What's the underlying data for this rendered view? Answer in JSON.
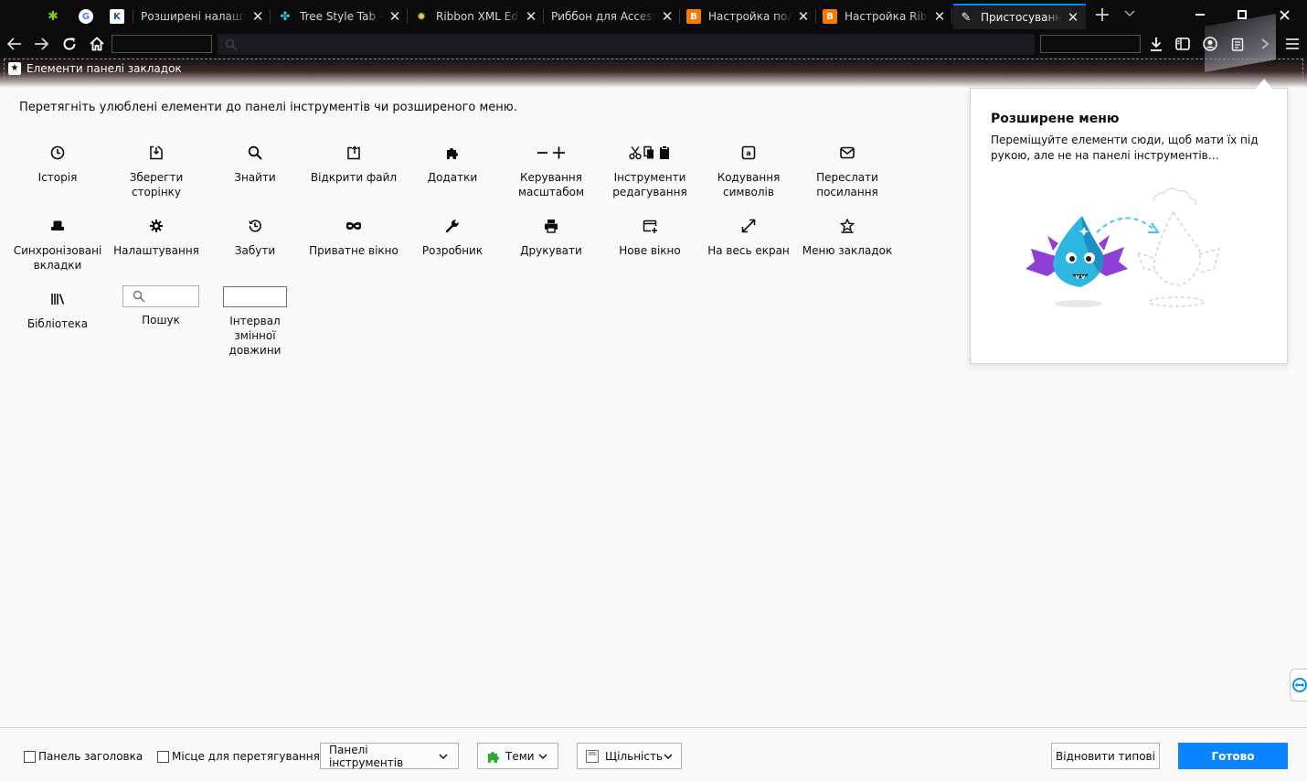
{
  "tabs": [
    {
      "title": "",
      "favicon": "puzzle-green"
    },
    {
      "title": "",
      "favicon": "google-g"
    },
    {
      "title": "",
      "favicon": "k-bookmark"
    },
    {
      "title": "Розширені налаштування",
      "favicon": "blank"
    },
    {
      "title": "Tree Style Tab – Get",
      "favicon": "tree-style-tab"
    },
    {
      "title": "Ribbon XML Editor",
      "favicon": "ribbon-bulb"
    },
    {
      "title": "Риббон для Access",
      "favicon": "none"
    },
    {
      "title": "Настройка пользов",
      "favicon": "blogger"
    },
    {
      "title": "Настройка Ribbon",
      "favicon": "blogger"
    },
    {
      "title": "Пристосування",
      "favicon": "brush"
    }
  ],
  "bookmarks_bar": {
    "label": "Елементи панелі закладок"
  },
  "instructions": "Перетягніть улюблені елементи до панелі інструментів чи розширеного меню.",
  "palette": {
    "rows": [
      [
        {
          "label": "Історія",
          "icon": "clock-icon"
        },
        {
          "label": "Зберегти сторінку",
          "icon": "save-page-icon"
        },
        {
          "label": "Знайти",
          "icon": "search-icon"
        },
        {
          "label": "Відкрити файл",
          "icon": "open-file-icon"
        },
        {
          "label": "Додатки",
          "icon": "puzzle-icon"
        },
        {
          "label": "Керування масштабом",
          "icon": "zoom-icon"
        },
        {
          "label": "Інструменти редагування",
          "icon": "edit-tools-icon"
        },
        {
          "label": "Кодування символів",
          "icon": "encoding-icon"
        },
        {
          "label": "Переслати посилання",
          "icon": "email-icon"
        }
      ],
      [
        {
          "label": "Синхронізовані вкладки",
          "icon": "synced-tabs-icon"
        },
        {
          "label": "Налаштування",
          "icon": "gear-icon"
        },
        {
          "label": "Забути",
          "icon": "forget-icon"
        },
        {
          "label": "Приватне вікно",
          "icon": "private-mask-icon"
        },
        {
          "label": "Розробник",
          "icon": "wrench-icon"
        },
        {
          "label": "Друкувати",
          "icon": "printer-icon"
        },
        {
          "label": "Нове вікно",
          "icon": "new-window-icon"
        },
        {
          "label": "На весь екран",
          "icon": "fullscreen-icon"
        },
        {
          "label": "Меню закладок",
          "icon": "bookmarks-menu-icon"
        }
      ],
      [
        {
          "label": "Бібліотека",
          "icon": "library-icon"
        },
        {
          "label": "Пошук",
          "icon": "search-field"
        },
        {
          "label": "Інтервал змінної довжини",
          "icon": "flexible-space"
        }
      ]
    ]
  },
  "overflow_panel": {
    "title": "Розширене меню",
    "description": "Переміщуйте елементи сюди, щоб мати їх під рукою, але не на панелі інструментів…"
  },
  "footer": {
    "title_bar_label": "Панель заголовка",
    "drag_space_label": "Місце для перетягування",
    "toolbars_label": "Панелі інструментів",
    "themes_label": "Теми",
    "density_label": "Щільність",
    "reset_label": "Відновити типові",
    "done_label": "Готово"
  },
  "colors": {
    "accent": "#0a84ff",
    "chrome": "#0b0b0c",
    "page": "#f9f9fa"
  }
}
